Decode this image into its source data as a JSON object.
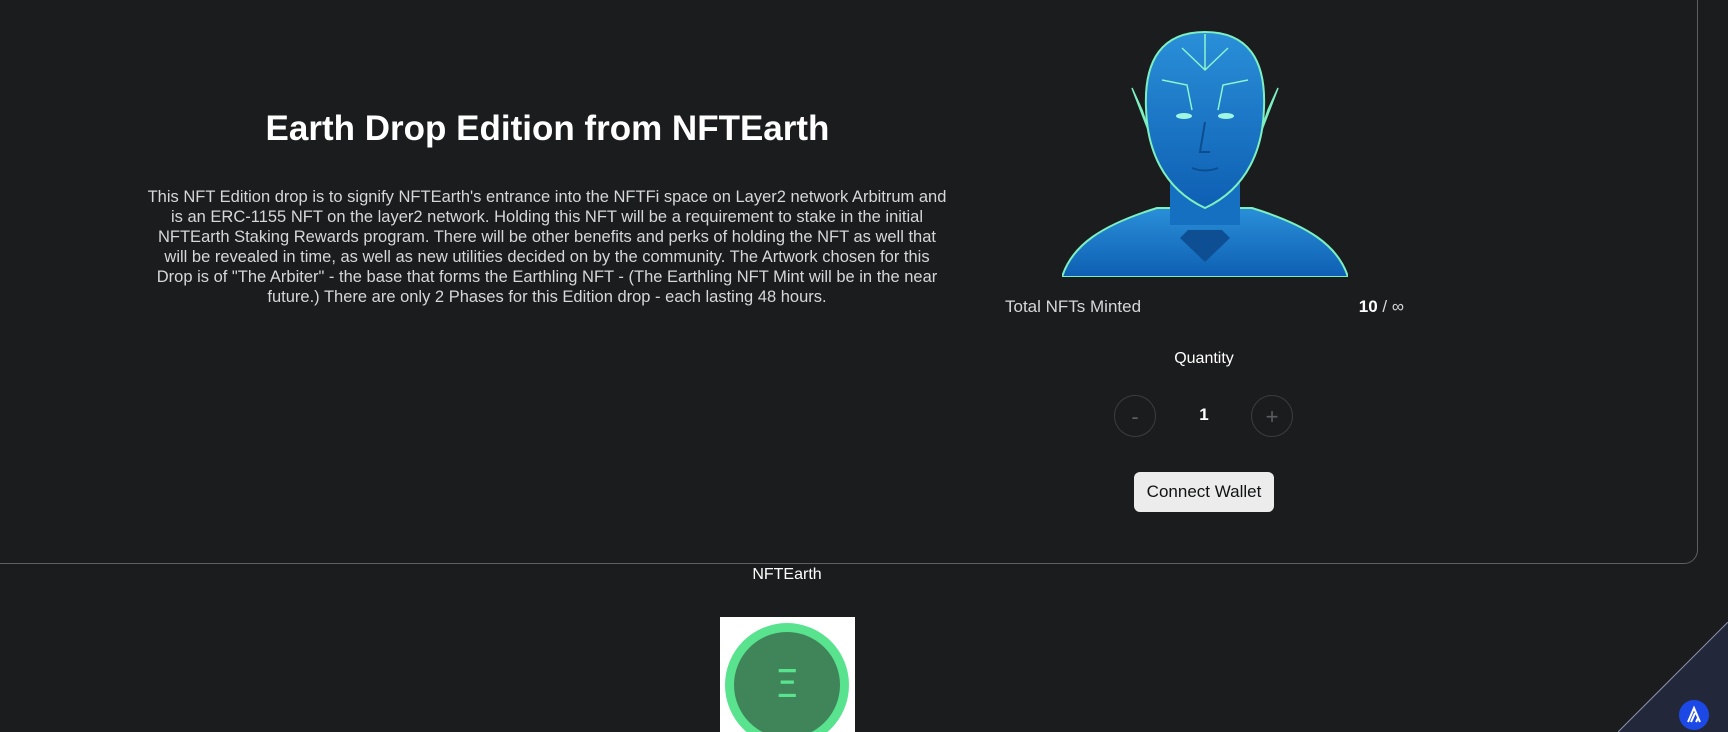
{
  "drop": {
    "title": "Earth Drop Edition from NFTEarth",
    "description": "This NFT Edition drop is to signify NFTEarth's entrance into the NFTFi space on Layer2 network Arbitrum and is an ERC-1155 NFT on the layer2 network. Holding this NFT will be a requirement to stake in the initial NFTEarth Staking Rewards program. There will be other benefits and perks of holding the NFT as well that will be revealed in time, as well as new utilities decided on by the community. The Artwork chosen for this Drop is of \"The Arbiter\" - the base that forms the Earthling NFT - (The Earthling NFT Mint will be in the near future.) There are only 2 Phases for this Edition drop - each lasting 48 hours.",
    "artwork_icon": "arbiter-artwork"
  },
  "mint": {
    "total_label": "Total NFTs Minted",
    "minted_count": "10",
    "separator": "/",
    "max_supply": "∞",
    "quantity_label": "Quantity",
    "decrement_label": "-",
    "increment_label": "+",
    "quantity_value": "1",
    "connect_label": "Connect Wallet"
  },
  "footer": {
    "brand": "NFTEarth",
    "logo_glyph": "Ξ"
  },
  "colors": {
    "background": "#1b1c1e",
    "panel_border": "#5d5f63",
    "button_bg": "#ececec",
    "logo_ring": "#5ae38e",
    "logo_inner": "#3f8559",
    "badge_blue": "#1c49e6"
  }
}
